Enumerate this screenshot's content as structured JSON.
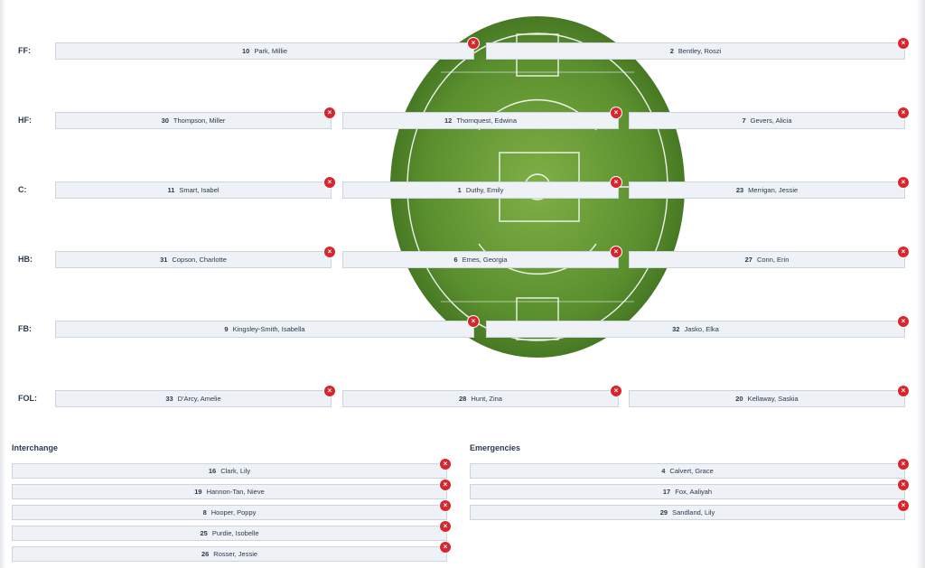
{
  "field": {
    "rows": [
      {
        "label": "FF:",
        "players": [
          {
            "num": "10",
            "name": "Park, Millie"
          },
          {
            "num": "2",
            "name": "Bentley, Roszi"
          }
        ]
      },
      {
        "label": "HF:",
        "players": [
          {
            "num": "30",
            "name": "Thompson, Miller"
          },
          {
            "num": "12",
            "name": "Thornquest, Edwina"
          },
          {
            "num": "7",
            "name": "Gevers, Alicia"
          }
        ]
      },
      {
        "label": "C:",
        "players": [
          {
            "num": "11",
            "name": "Smart, Isabel"
          },
          {
            "num": "1",
            "name": "Duthy, Emily"
          },
          {
            "num": "23",
            "name": "Merrigan, Jessie"
          }
        ]
      },
      {
        "label": "HB:",
        "players": [
          {
            "num": "31",
            "name": "Copson, Charlotte"
          },
          {
            "num": "6",
            "name": "Emes, Georgia"
          },
          {
            "num": "27",
            "name": "Conn, Erin"
          }
        ]
      },
      {
        "label": "FB:",
        "players": [
          {
            "num": "9",
            "name": "Kingsley-Smith, Isabella"
          },
          {
            "num": "32",
            "name": "Jasko, Elka"
          }
        ]
      },
      {
        "label": "FOL:",
        "players": [
          {
            "num": "33",
            "name": "D'Arcy, Amelie"
          },
          {
            "num": "28",
            "name": "Hunt, Zina"
          },
          {
            "num": "20",
            "name": "Kellaway, Saskia"
          }
        ]
      }
    ]
  },
  "interchange": {
    "title": "Interchange",
    "players": [
      {
        "num": "16",
        "name": "Clark, Lily"
      },
      {
        "num": "19",
        "name": "Hannon-Tan, Nieve"
      },
      {
        "num": "8",
        "name": "Hooper, Poppy"
      },
      {
        "num": "25",
        "name": "Purdie, Isobelle"
      },
      {
        "num": "26",
        "name": "Rosser, Jessie"
      }
    ]
  },
  "emergencies": {
    "title": "Emergencies",
    "players": [
      {
        "num": "4",
        "name": "Calvert, Grace"
      },
      {
        "num": "17",
        "name": "Fox, Aaliyah"
      },
      {
        "num": "29",
        "name": "Sandland, Lily"
      }
    ]
  },
  "remove_symbol": "×",
  "colors": {
    "remove": "#d7262d",
    "grass": "#5a8f2e",
    "slot_bg": "#eef1f6"
  }
}
